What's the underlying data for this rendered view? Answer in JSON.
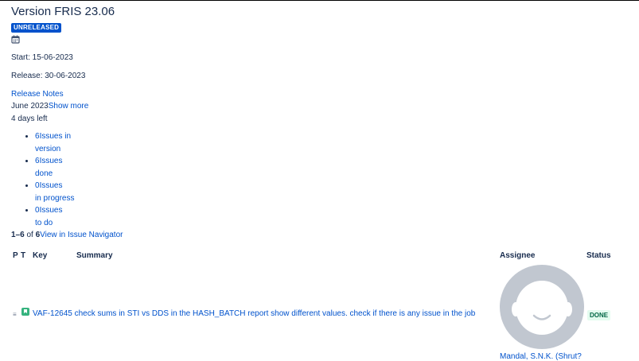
{
  "version": {
    "title": "Version FRIS 23.06",
    "status": "UNRELEASED",
    "start": "Start: 15-06-2023",
    "release": "Release: 30-06-2023",
    "release_notes": "Release Notes",
    "description_prefix": "June 2023",
    "show_more": "Show more",
    "days_left": "4 days left"
  },
  "stats": [
    {
      "count": "6",
      "label_line1": "Issues in",
      "label_line2": "version"
    },
    {
      "count": "6",
      "label_line1": "Issues",
      "label_line2": "done"
    },
    {
      "count": "0",
      "label_line1": "Issues",
      "label_line2": "in progress"
    },
    {
      "count": "0",
      "label_line1": "Issues",
      "label_line2": "to do"
    }
  ],
  "pagination": {
    "range": "1–6",
    "of": " of ",
    "total": "6",
    "navigator_link": "View in Issue Navigator"
  },
  "table": {
    "headers": {
      "p": "P",
      "t": "T",
      "key": "Key",
      "summary": "Summary",
      "assignee": "Assignee",
      "status": "Status"
    },
    "rows": [
      {
        "key": "VAF-12645",
        "summary": "check sums in STI vs DDS in the HASH_BATCH report show different values. check if there is any issue in the job",
        "assignee": "Mandal, S.N.K. (Shrut?",
        "status": "DONE"
      }
    ]
  },
  "icons": {
    "calendar": "calendar-icon",
    "priority": "priority-low-icon",
    "issue_type": "story-icon",
    "avatar": "default-avatar"
  },
  "colors": {
    "link": "#0052cc",
    "lozenge_unreleased": "#0052cc",
    "done_bg": "#e3fcef",
    "done_text": "#006644",
    "story": "#36b37e"
  }
}
